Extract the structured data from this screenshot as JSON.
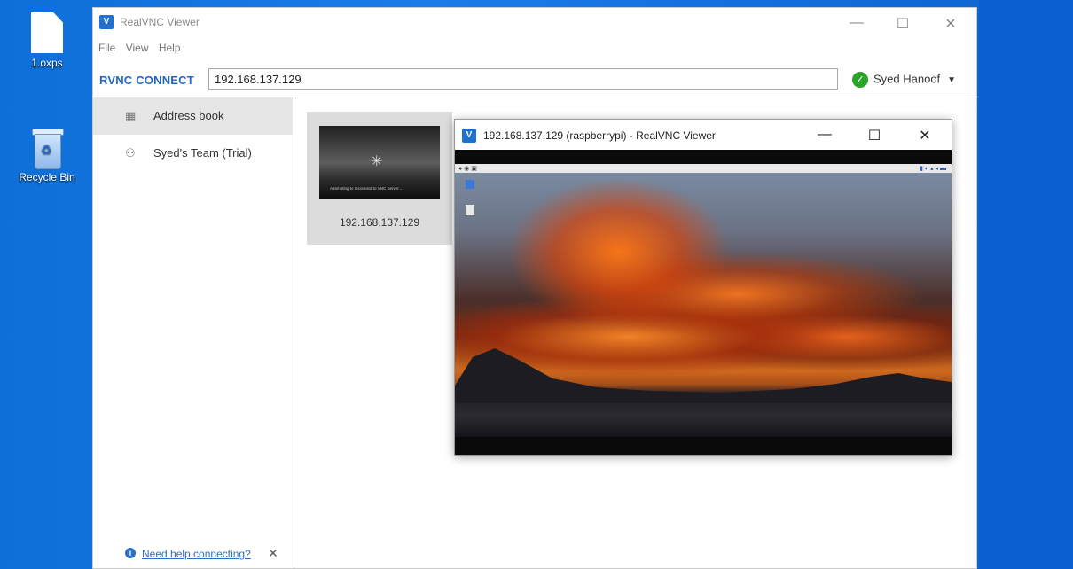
{
  "desktop": {
    "icons": [
      {
        "label": "1.oxps",
        "icon": "file-icon"
      },
      {
        "label": "Recycle Bin",
        "icon": "recycle-bin-icon"
      }
    ]
  },
  "main_window": {
    "title": "RealVNC Viewer",
    "controls": {
      "minimize": "—",
      "maximize": "☐",
      "close": "✕"
    },
    "menu": [
      "File",
      "View",
      "Help"
    ],
    "brand": "RVNC CONNECT",
    "address_value": "192.168.137.129",
    "account": {
      "name": "Syed Hanoof",
      "status_color": "#2aa52a"
    },
    "sidebar": {
      "items": [
        {
          "label": "Address book",
          "icon": "address-book-icon"
        },
        {
          "label": "Syed's Team (Trial)",
          "icon": "team-icon"
        }
      ],
      "help_link": "Need help connecting?",
      "help_close": "✕"
    },
    "tile": {
      "label": "192.168.137.129",
      "thumb_message": "Attempting to reconnect to VNC Server..."
    }
  },
  "session_window": {
    "title": "192.168.137.129 (raspberrypi) - RealVNC Viewer",
    "controls": {
      "minimize": "—",
      "maximize": "☐",
      "close": "✕"
    }
  },
  "colors": {
    "accent": "#2368c4",
    "desktop": "#1a7ce8",
    "link": "#2d6ec8"
  }
}
